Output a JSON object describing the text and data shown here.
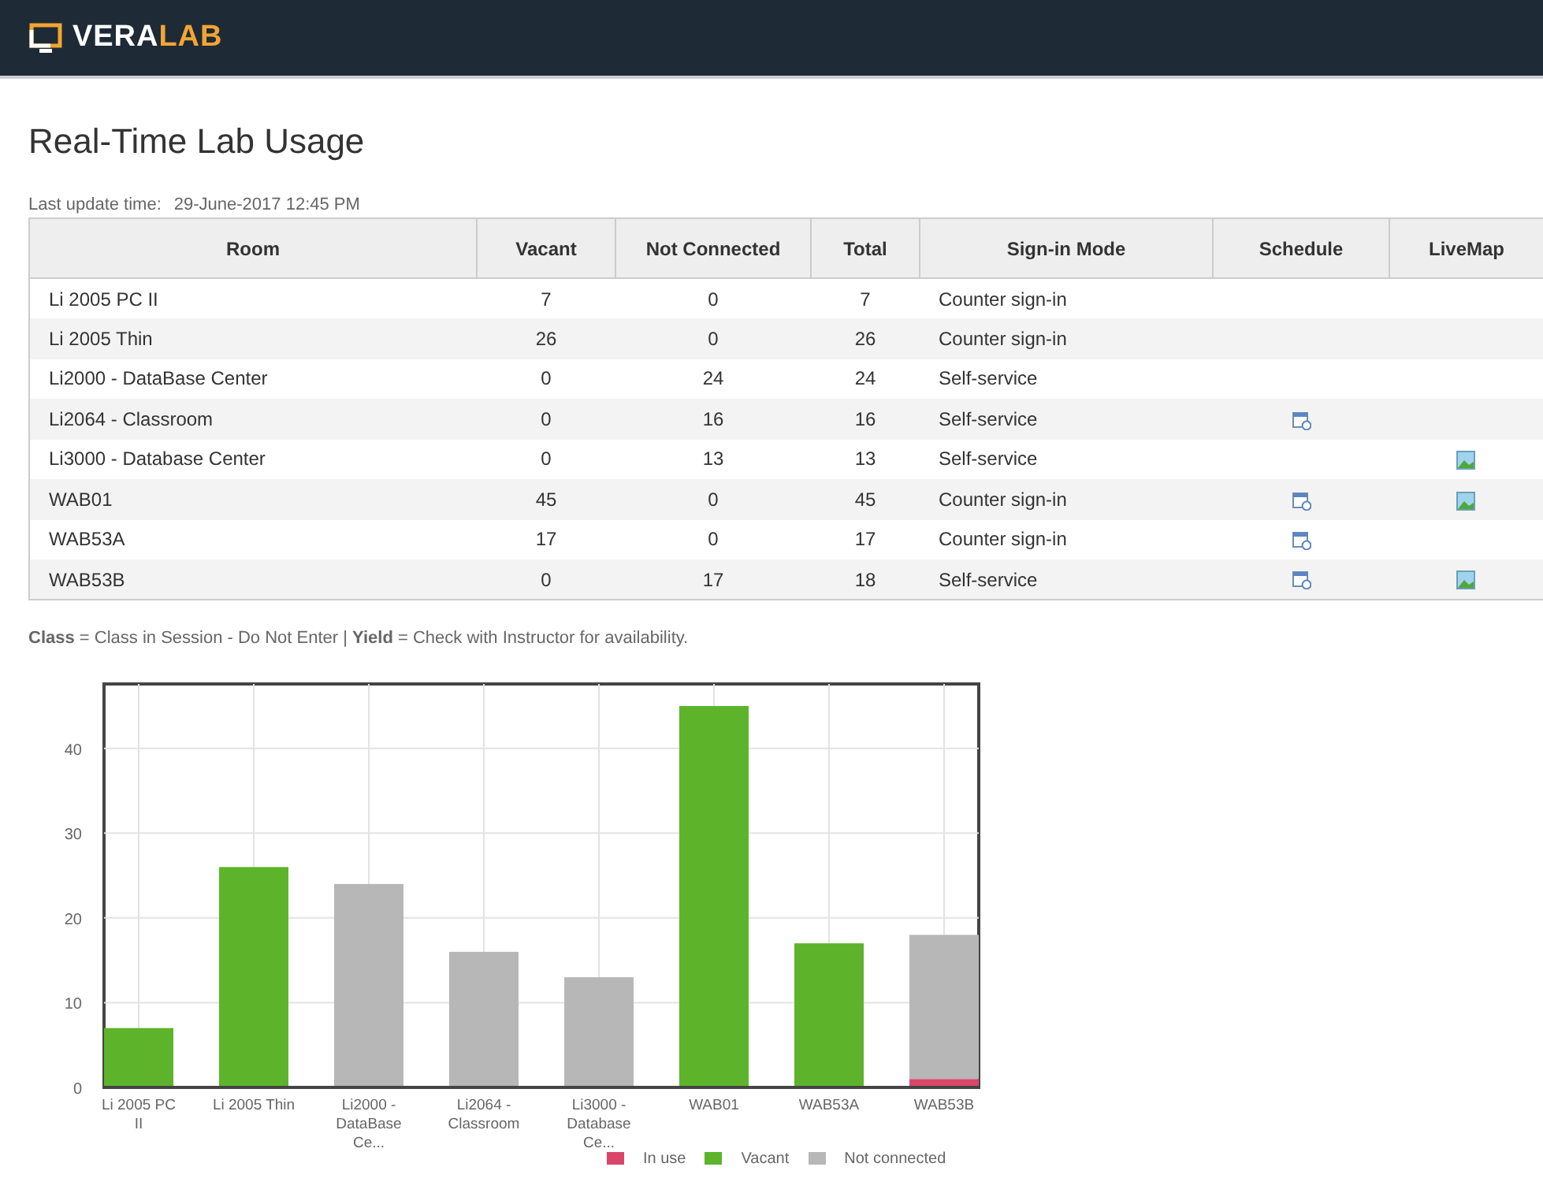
{
  "header": {
    "logo_part_1": "VERA",
    "logo_part_2": "LAB"
  },
  "page_title": "Real-Time Lab Usage",
  "last_update": {
    "label": "Last update time:",
    "value": "29-June-2017 12:45 PM"
  },
  "table": {
    "columns": [
      "Room",
      "Vacant",
      "Not Connected",
      "Total",
      "Sign-in Mode",
      "Schedule",
      "LiveMap"
    ],
    "rows": [
      {
        "room": "Li 2005 PC II",
        "vacant": "7",
        "not_connected": "0",
        "total": "7",
        "mode": "Counter sign-in",
        "schedule": false,
        "livemap": false
      },
      {
        "room": "Li 2005 Thin",
        "vacant": "26",
        "not_connected": "0",
        "total": "26",
        "mode": "Counter sign-in",
        "schedule": false,
        "livemap": false
      },
      {
        "room": "Li2000 - DataBase Center",
        "vacant": "0",
        "not_connected": "24",
        "total": "24",
        "mode": "Self-service",
        "schedule": false,
        "livemap": false
      },
      {
        "room": "Li2064 - Classroom",
        "vacant": "0",
        "not_connected": "16",
        "total": "16",
        "mode": "Self-service",
        "schedule": true,
        "livemap": false
      },
      {
        "room": "Li3000 - Database Center",
        "vacant": "0",
        "not_connected": "13",
        "total": "13",
        "mode": "Self-service",
        "schedule": false,
        "livemap": true
      },
      {
        "room": "WAB01",
        "vacant": "45",
        "not_connected": "0",
        "total": "45",
        "mode": "Counter sign-in",
        "schedule": true,
        "livemap": true
      },
      {
        "room": "WAB53A",
        "vacant": "17",
        "not_connected": "0",
        "total": "17",
        "mode": "Counter sign-in",
        "schedule": true,
        "livemap": false
      },
      {
        "room": "WAB53B",
        "vacant": "0",
        "not_connected": "17",
        "total": "18",
        "mode": "Self-service",
        "schedule": true,
        "livemap": true
      }
    ]
  },
  "legend_note": "**Class** = Class in Session - Do Not Enter | **Yield** = Check with Instructor for availability.",
  "chart": {
    "chart_data": {
      "type": "bar",
      "stacked": true,
      "categories": [
        "Li 2005 PC\nII",
        "Li 2005 Thin",
        "Li2000 -\nDataBase\nCe...",
        "Li2064 -\nClassroom",
        "Li3000 -\nDatabase\nCe...",
        "WAB01",
        "WAB53A",
        "WAB53B"
      ],
      "grid": true,
      "series": [
        {
          "name": "In use",
          "color": "#d9466a",
          "values": [
            0,
            0,
            0,
            0,
            0,
            0,
            0,
            1
          ]
        },
        {
          "name": "Vacant",
          "color": "#5db42a",
          "values": [
            7,
            26,
            0,
            0,
            0,
            45,
            17,
            0
          ]
        },
        {
          "name": "Not connected",
          "color": "#b7b7b7",
          "values": [
            0,
            0,
            24,
            16,
            13,
            0,
            0,
            17
          ]
        }
      ],
      "ylim": [
        0,
        47.6
      ],
      "yticks": [
        0,
        10,
        20,
        30,
        40
      ]
    }
  }
}
